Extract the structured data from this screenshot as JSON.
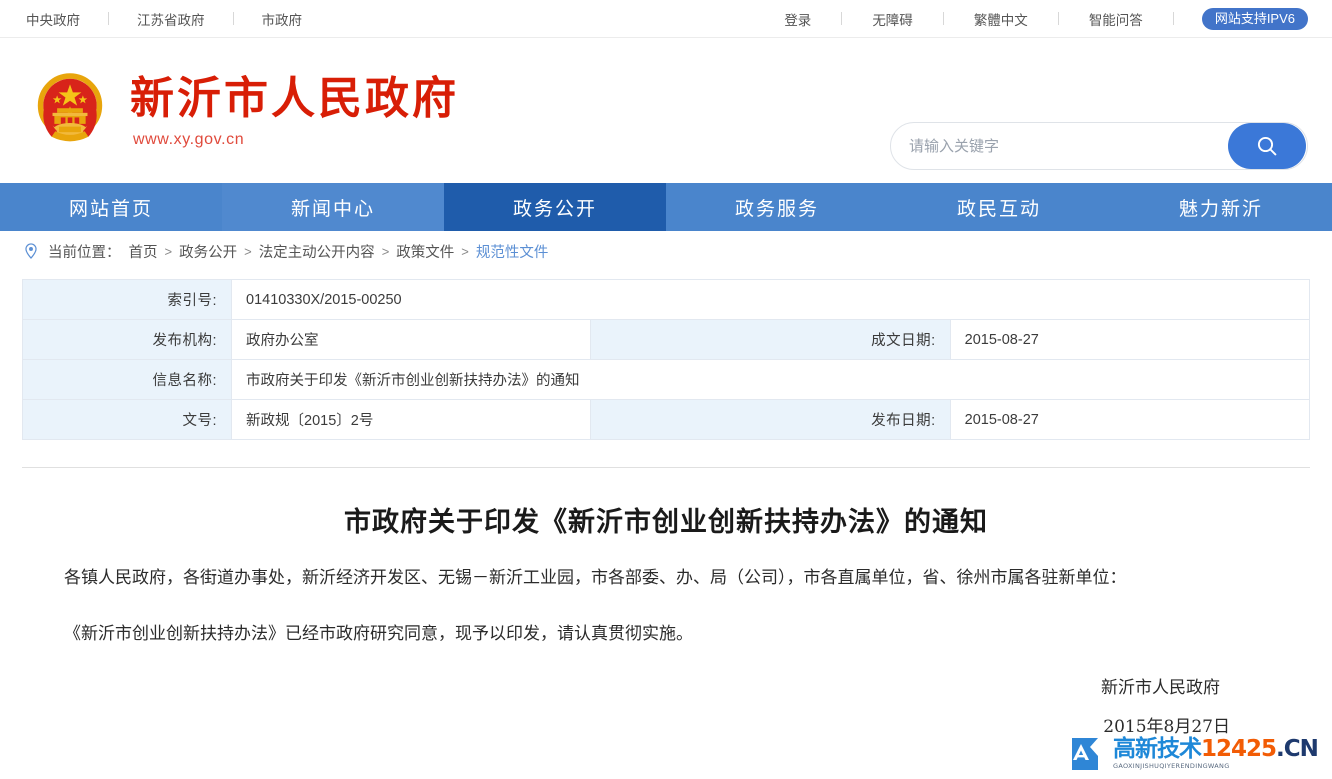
{
  "topbar": {
    "left_links": [
      "中央政府",
      "江苏省政府",
      "市政府"
    ],
    "right_links": [
      "登录",
      "无障碍",
      "繁體中文",
      "智能问答"
    ],
    "ipv6_badge": "网站支持IPV6"
  },
  "header": {
    "emblem_icon": "national-emblem-icon",
    "site_title": "新沂市人民政府",
    "site_url": "www.xy.gov.cn",
    "search": {
      "placeholder": "请输入关键字",
      "value": "",
      "button_icon": "search-icon"
    }
  },
  "nav": {
    "items": [
      {
        "label": "网站首页",
        "active": false
      },
      {
        "label": "新闻中心",
        "active": false
      },
      {
        "label": "政务公开",
        "active": true
      },
      {
        "label": "政务服务",
        "active": false
      },
      {
        "label": "政民互动",
        "active": false
      },
      {
        "label": "魅力新沂",
        "active": false
      }
    ]
  },
  "breadcrumb": {
    "pin_icon": "location-pin-icon",
    "label": "当前位置：",
    "separator": ">",
    "items": [
      "首页",
      "政务公开",
      "法定主动公开内容",
      "政策文件",
      "规范性文件"
    ]
  },
  "info_table": {
    "rows": [
      {
        "label": "索引号:",
        "value": "01410330X/2015-00250",
        "label2": "",
        "value2": "",
        "span": true
      },
      {
        "label": "发布机构:",
        "value": "政府办公室",
        "label2": "成文日期:",
        "value2": "2015-08-27",
        "span": false
      },
      {
        "label": "信息名称:",
        "value": "市政府关于印发《新沂市创业创新扶持办法》的通知",
        "label2": "",
        "value2": "",
        "span": true
      },
      {
        "label": "文号:",
        "value": "新政规〔2015〕2号",
        "label2": "发布日期:",
        "value2": "2015-08-27",
        "span": false
      }
    ]
  },
  "article": {
    "title": "市政府关于印发《新沂市创业创新扶持办法》的通知",
    "paragraph1": "各镇人民政府，各街道办事处，新沂经济开发区、无锡－新沂工业园，市各部委、办、局（公司），市各直属单位，省、徐州市属各驻新单位：",
    "paragraph2": "《新沂市创业创新扶持办法》已经市政府研究同意，现予以印发，请认真贯彻实施。",
    "signature": "新沂市人民政府",
    "date": "2015年8月27日"
  },
  "watermark": {
    "logo_icon": "watermark-logo-icon",
    "cn_text": "高新技术",
    "number": "12425",
    "domain": ".CN",
    "subtitle": "GAOXINJISHUQIYERENDINGWANG"
  },
  "colors": {
    "brand_red": "#d81e06",
    "nav_blue": "#4a85cc",
    "nav_active_blue": "#1f5cab",
    "accent_blue": "#3b78d8",
    "label_bg": "#eaf3fb"
  }
}
